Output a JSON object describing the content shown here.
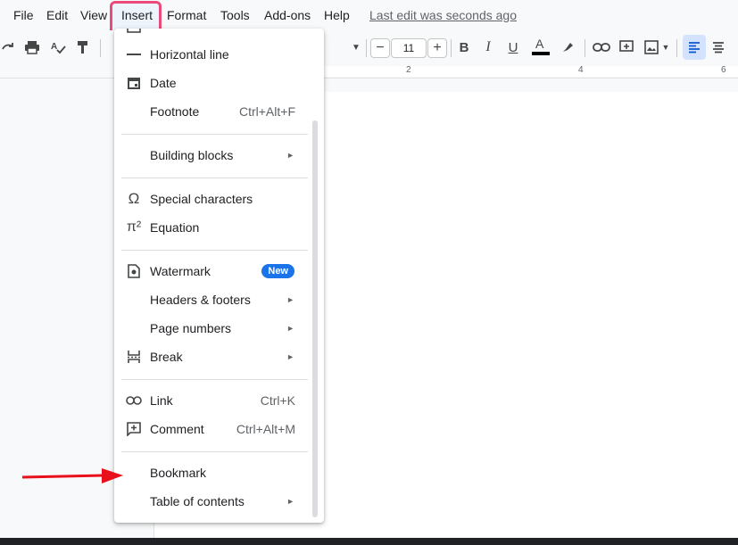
{
  "menubar": {
    "items": [
      "File",
      "Edit",
      "View",
      "Insert",
      "Format",
      "Tools",
      "Add-ons",
      "Help"
    ],
    "last_edit": "Last edit was seconds ago"
  },
  "toolbar": {
    "font_size": "11",
    "minus": "−",
    "plus": "+"
  },
  "ruler": {
    "ticks": [
      "2",
      "4",
      "6"
    ]
  },
  "insert_menu": {
    "items": [
      {
        "label": "Horizontal line",
        "icon": "horizontal-line-icon"
      },
      {
        "label": "Date",
        "icon": "calendar-icon"
      },
      {
        "label": "Footnote",
        "shortcut": "Ctrl+Alt+F"
      },
      {
        "label": "Building blocks",
        "submenu": true
      },
      {
        "label": "Special characters",
        "icon": "omega-icon"
      },
      {
        "label": "Equation",
        "icon": "pi-icon"
      },
      {
        "label": "Watermark",
        "icon": "watermark-icon",
        "badge": "New"
      },
      {
        "label": "Headers & footers",
        "submenu": true
      },
      {
        "label": "Page numbers",
        "submenu": true
      },
      {
        "label": "Break",
        "icon": "break-icon",
        "submenu": true
      },
      {
        "label": "Link",
        "icon": "link-icon",
        "shortcut": "Ctrl+K"
      },
      {
        "label": "Comment",
        "icon": "comment-icon",
        "shortcut": "Ctrl+Alt+M"
      },
      {
        "label": "Bookmark"
      },
      {
        "label": "Table of contents",
        "submenu": true
      }
    ]
  },
  "colors": {
    "highlight_border": "#e94c7a",
    "badge": "#1a73e8",
    "arrow": "#e8101a"
  }
}
